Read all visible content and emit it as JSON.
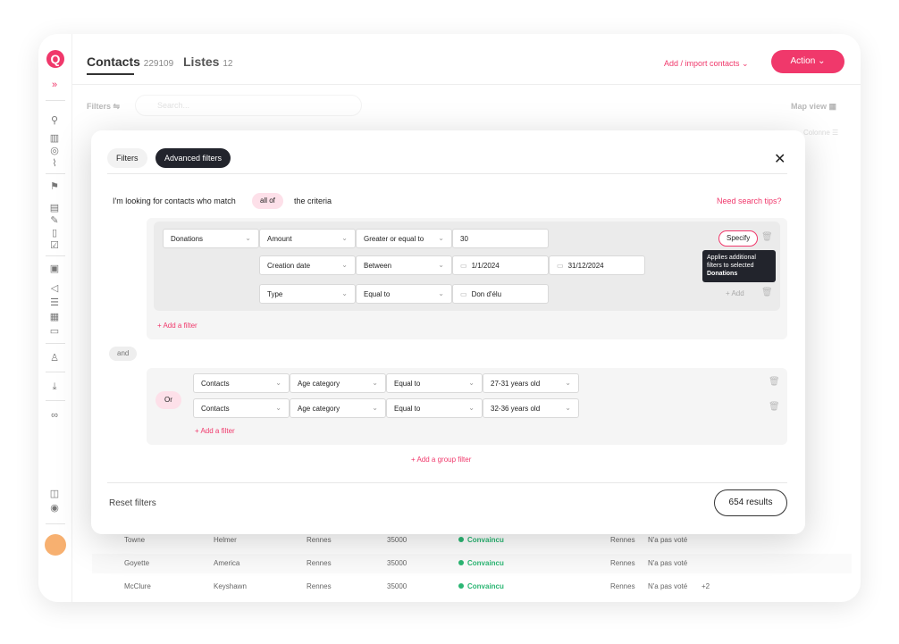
{
  "background": {
    "title": "Contacts",
    "contacts_count": "229109",
    "lists_label": "Listes",
    "lists_count": "12",
    "add_import": "Add / import contacts",
    "action": "Action",
    "filters": "Filters",
    "search_placeholder": "Search...",
    "map_view": "Map view",
    "colonne": "Colonne",
    "rows": [
      {
        "last": "Towne",
        "first": "Helmer",
        "city": "Rennes",
        "zip": "35000",
        "status": "Convaincu",
        "city2": "Rennes",
        "vote": "N'a pas voté",
        "extra": ""
      },
      {
        "last": "Goyette",
        "first": "America",
        "city": "Rennes",
        "zip": "35000",
        "status": "Convaincu",
        "city2": "Rennes",
        "vote": "N'a pas voté",
        "extra": ""
      },
      {
        "last": "McClure",
        "first": "Keyshawn",
        "city": "Rennes",
        "zip": "35000",
        "status": "Convaincu",
        "city2": "Rennes",
        "vote": "N'a pas voté",
        "extra": "+2"
      }
    ]
  },
  "modal": {
    "tab_filters": "Filters",
    "tab_advanced": "Advanced filters",
    "criteria_prefix": "I'm looking for contacts who match",
    "criteria_match": "all of",
    "criteria_suffix": "the criteria",
    "search_tips": "Need search tips?",
    "group1": {
      "row1": {
        "entity": "Donations",
        "field": "Amount",
        "operator": "Greater or equal to",
        "value": "30"
      },
      "row2": {
        "field": "Creation date",
        "operator": "Between",
        "from": "1/1/2024",
        "to": "31/12/2024"
      },
      "row3": {
        "field": "Type",
        "operator": "Equal to",
        "value": "Don d'élu"
      },
      "specify": "Specify",
      "tooltip_line1": "Applies additional",
      "tooltip_line2": "filters to selected",
      "tooltip_line3": "Donations",
      "add": "Add",
      "add_filter": "Add a filter"
    },
    "and_label": "and",
    "group2": {
      "or_label": "Or",
      "row1": {
        "entity": "Contacts",
        "field": "Age category",
        "operator": "Equal to",
        "value": "27-31 years old"
      },
      "row2": {
        "entity": "Contacts",
        "field": "Age category",
        "operator": "Equal to",
        "value": "32-36 years old"
      },
      "add_filter": "Add a filter"
    },
    "add_group_filter": "Add a group filter",
    "reset_filters": "Reset filters",
    "results": "654 results"
  }
}
